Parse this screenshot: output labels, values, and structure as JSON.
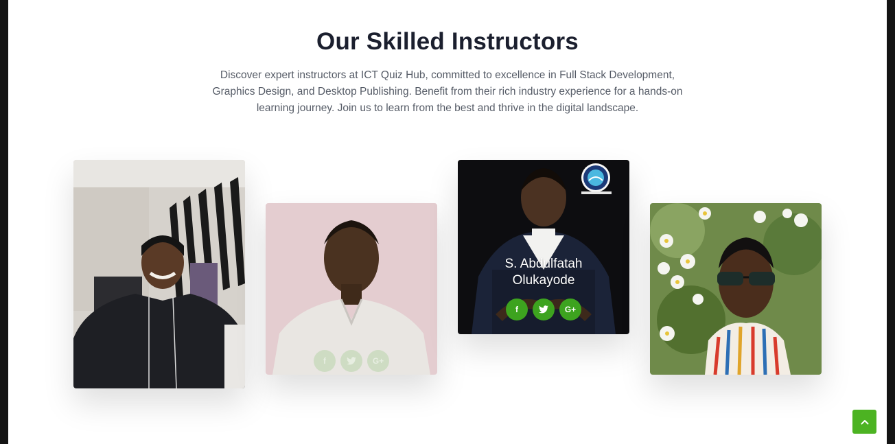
{
  "section": {
    "title": "Our Skilled Instructors",
    "description": "Discover expert instructors at ICT Quiz Hub, committed to excellence in Full Stack Development, Graphics Design, and Desktop Publishing. Benefit from their rich industry experience for a hands-on learning journey. Join us to learn from the best and thrive in the digital landscape."
  },
  "instructors": [
    {
      "name": "",
      "socials": []
    },
    {
      "name": "",
      "socials": [
        "facebook-icon",
        "twitter-icon",
        "google-plus-icon"
      ]
    },
    {
      "name_line1": "S. Abdulfatah",
      "name_line2": "Olukayode",
      "socials": [
        "facebook-icon",
        "twitter-icon",
        "google-plus-icon"
      ]
    },
    {
      "name": "",
      "socials": []
    }
  ],
  "social_glyphs": {
    "facebook": "f",
    "google_plus": "G+"
  },
  "back_to_top": {
    "icon": "chevron-up-icon"
  },
  "colors": {
    "accent_green": "#3da31f",
    "back_to_top": "#4cb322",
    "heading": "#1b1f2e",
    "text": "#555b66"
  }
}
